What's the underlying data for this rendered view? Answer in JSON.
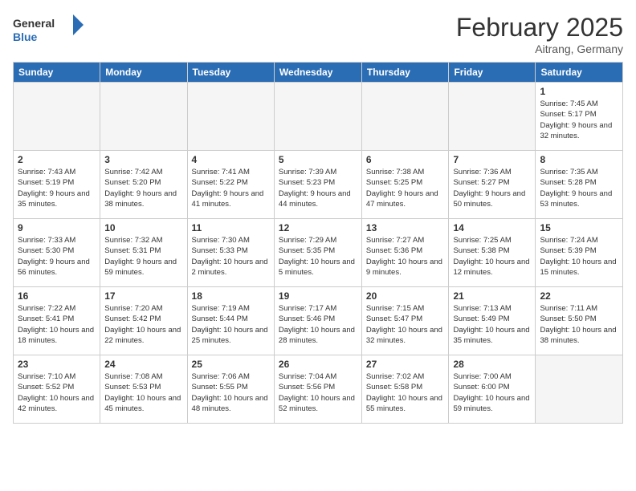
{
  "header": {
    "logo_line1": "General",
    "logo_line2": "Blue",
    "month_year": "February 2025",
    "location": "Aitrang, Germany"
  },
  "weekdays": [
    "Sunday",
    "Monday",
    "Tuesday",
    "Wednesday",
    "Thursday",
    "Friday",
    "Saturday"
  ],
  "weeks": [
    [
      {
        "day": "",
        "info": ""
      },
      {
        "day": "",
        "info": ""
      },
      {
        "day": "",
        "info": ""
      },
      {
        "day": "",
        "info": ""
      },
      {
        "day": "",
        "info": ""
      },
      {
        "day": "",
        "info": ""
      },
      {
        "day": "1",
        "info": "Sunrise: 7:45 AM\nSunset: 5:17 PM\nDaylight: 9 hours and 32 minutes."
      }
    ],
    [
      {
        "day": "2",
        "info": "Sunrise: 7:43 AM\nSunset: 5:19 PM\nDaylight: 9 hours and 35 minutes."
      },
      {
        "day": "3",
        "info": "Sunrise: 7:42 AM\nSunset: 5:20 PM\nDaylight: 9 hours and 38 minutes."
      },
      {
        "day": "4",
        "info": "Sunrise: 7:41 AM\nSunset: 5:22 PM\nDaylight: 9 hours and 41 minutes."
      },
      {
        "day": "5",
        "info": "Sunrise: 7:39 AM\nSunset: 5:23 PM\nDaylight: 9 hours and 44 minutes."
      },
      {
        "day": "6",
        "info": "Sunrise: 7:38 AM\nSunset: 5:25 PM\nDaylight: 9 hours and 47 minutes."
      },
      {
        "day": "7",
        "info": "Sunrise: 7:36 AM\nSunset: 5:27 PM\nDaylight: 9 hours and 50 minutes."
      },
      {
        "day": "8",
        "info": "Sunrise: 7:35 AM\nSunset: 5:28 PM\nDaylight: 9 hours and 53 minutes."
      }
    ],
    [
      {
        "day": "9",
        "info": "Sunrise: 7:33 AM\nSunset: 5:30 PM\nDaylight: 9 hours and 56 minutes."
      },
      {
        "day": "10",
        "info": "Sunrise: 7:32 AM\nSunset: 5:31 PM\nDaylight: 9 hours and 59 minutes."
      },
      {
        "day": "11",
        "info": "Sunrise: 7:30 AM\nSunset: 5:33 PM\nDaylight: 10 hours and 2 minutes."
      },
      {
        "day": "12",
        "info": "Sunrise: 7:29 AM\nSunset: 5:35 PM\nDaylight: 10 hours and 5 minutes."
      },
      {
        "day": "13",
        "info": "Sunrise: 7:27 AM\nSunset: 5:36 PM\nDaylight: 10 hours and 9 minutes."
      },
      {
        "day": "14",
        "info": "Sunrise: 7:25 AM\nSunset: 5:38 PM\nDaylight: 10 hours and 12 minutes."
      },
      {
        "day": "15",
        "info": "Sunrise: 7:24 AM\nSunset: 5:39 PM\nDaylight: 10 hours and 15 minutes."
      }
    ],
    [
      {
        "day": "16",
        "info": "Sunrise: 7:22 AM\nSunset: 5:41 PM\nDaylight: 10 hours and 18 minutes."
      },
      {
        "day": "17",
        "info": "Sunrise: 7:20 AM\nSunset: 5:42 PM\nDaylight: 10 hours and 22 minutes."
      },
      {
        "day": "18",
        "info": "Sunrise: 7:19 AM\nSunset: 5:44 PM\nDaylight: 10 hours and 25 minutes."
      },
      {
        "day": "19",
        "info": "Sunrise: 7:17 AM\nSunset: 5:46 PM\nDaylight: 10 hours and 28 minutes."
      },
      {
        "day": "20",
        "info": "Sunrise: 7:15 AM\nSunset: 5:47 PM\nDaylight: 10 hours and 32 minutes."
      },
      {
        "day": "21",
        "info": "Sunrise: 7:13 AM\nSunset: 5:49 PM\nDaylight: 10 hours and 35 minutes."
      },
      {
        "day": "22",
        "info": "Sunrise: 7:11 AM\nSunset: 5:50 PM\nDaylight: 10 hours and 38 minutes."
      }
    ],
    [
      {
        "day": "23",
        "info": "Sunrise: 7:10 AM\nSunset: 5:52 PM\nDaylight: 10 hours and 42 minutes."
      },
      {
        "day": "24",
        "info": "Sunrise: 7:08 AM\nSunset: 5:53 PM\nDaylight: 10 hours and 45 minutes."
      },
      {
        "day": "25",
        "info": "Sunrise: 7:06 AM\nSunset: 5:55 PM\nDaylight: 10 hours and 48 minutes."
      },
      {
        "day": "26",
        "info": "Sunrise: 7:04 AM\nSunset: 5:56 PM\nDaylight: 10 hours and 52 minutes."
      },
      {
        "day": "27",
        "info": "Sunrise: 7:02 AM\nSunset: 5:58 PM\nDaylight: 10 hours and 55 minutes."
      },
      {
        "day": "28",
        "info": "Sunrise: 7:00 AM\nSunset: 6:00 PM\nDaylight: 10 hours and 59 minutes."
      },
      {
        "day": "",
        "info": ""
      }
    ]
  ]
}
